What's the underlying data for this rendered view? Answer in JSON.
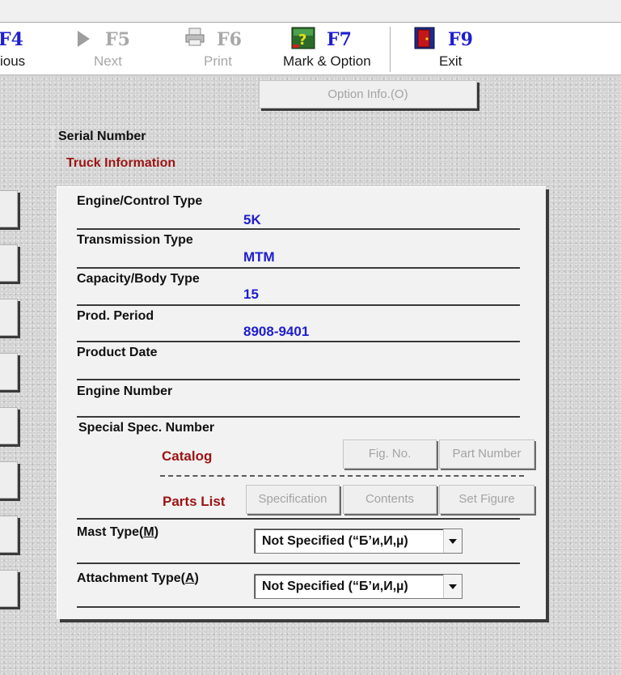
{
  "toolbar": {
    "buttons": [
      {
        "key": "F4",
        "label": "ious",
        "enabled": true
      },
      {
        "key": "F5",
        "label": "Next",
        "enabled": false
      },
      {
        "key": "F6",
        "label": "Print",
        "enabled": false
      },
      {
        "key": "F7",
        "label": "Mark & Option",
        "enabled": true
      },
      {
        "key": "F9",
        "label": "Exit",
        "enabled": true
      }
    ]
  },
  "option_info_button": "Option Info.(O)",
  "serial_number_label": "Serial Number",
  "truck_info_title": "Truck Information",
  "fields": {
    "engine_control_type": {
      "label": "Engine/Control Type",
      "value": "5K"
    },
    "transmission_type": {
      "label": "Transmission Type",
      "value": "MTM"
    },
    "capacity_body_type": {
      "label": "Capacity/Body Type",
      "value": "15"
    },
    "prod_period": {
      "label": "Prod. Period",
      "value": "8908-9401"
    },
    "product_date": {
      "label": "Product Date",
      "value": ""
    },
    "engine_number": {
      "label": "Engine Number",
      "value": ""
    },
    "special_spec_number": {
      "label": "Special Spec. Number",
      "value": ""
    }
  },
  "catalog": {
    "label": "Catalog",
    "fig_no_button": "Fig. No.",
    "part_number_button": "Part Number"
  },
  "parts_list": {
    "label": "Parts List",
    "specification_button": "Specification",
    "contents_button": "Contents",
    "set_figure_button": "Set Figure"
  },
  "mast_type": {
    "label_prefix": "Mast Type(",
    "hotkey": "M",
    "label_suffix": ")",
    "selected": "Not Specified (“Б’и,И,µ)"
  },
  "attachment_type": {
    "label_prefix": "Attachment Type(",
    "hotkey": "A",
    "label_suffix": ")",
    "selected": "Not Specified (“Б’и,И,µ)"
  },
  "colors": {
    "accent_blue": "#1e1ecf",
    "title_red": "#9c1414",
    "disabled_gray": "#a8a8a8"
  }
}
